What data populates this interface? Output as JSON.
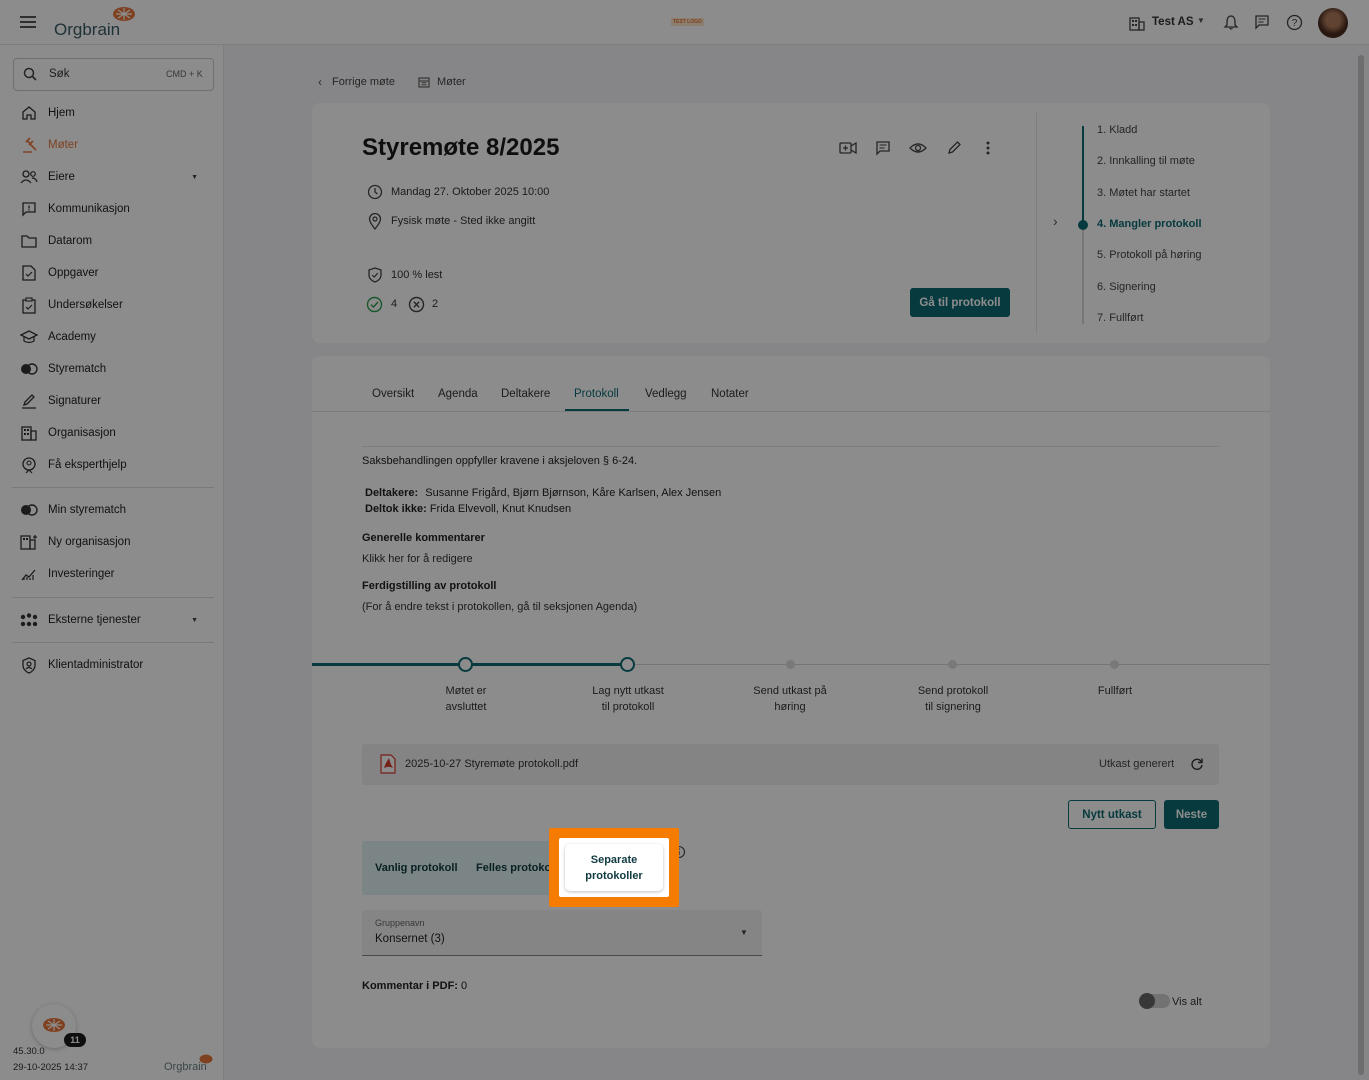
{
  "topbar": {
    "logo_text": "Orgbrain",
    "test_logo": "TEST LOGO",
    "org_name": "Test AS"
  },
  "sidebar": {
    "search_label": "Søk",
    "search_shortcut": "CMD + K",
    "items": [
      {
        "label": "Hjem",
        "icon": "home-icon"
      },
      {
        "label": "Møter",
        "icon": "gavel-icon"
      },
      {
        "label": "Eiere",
        "icon": "people-icon"
      },
      {
        "label": "Kommunikasjon",
        "icon": "message-icon"
      },
      {
        "label": "Datarom",
        "icon": "folder-icon"
      },
      {
        "label": "Oppgaver",
        "icon": "task-icon"
      },
      {
        "label": "Undersøkelser",
        "icon": "clipboard-icon"
      },
      {
        "label": "Academy",
        "icon": "graduation-icon"
      },
      {
        "label": "Styrematch",
        "icon": "match-icon"
      },
      {
        "label": "Signaturer",
        "icon": "pen-icon"
      },
      {
        "label": "Organisasjon",
        "icon": "building-icon"
      },
      {
        "label": "Få eksperthjelp",
        "icon": "expert-icon"
      }
    ],
    "items2": [
      {
        "label": "Min styrematch",
        "icon": "match-icon"
      },
      {
        "label": "Ny organisasjon",
        "icon": "building-plus-icon"
      },
      {
        "label": "Investeringer",
        "icon": "chart-icon"
      }
    ],
    "external_services": "Eksterne tjenester",
    "client_admin": "Klientadministrator",
    "badge_count": "11",
    "version": "45.30.0",
    "version_date": "29-10-2025 14:37",
    "footer_logo": "Orgbrain"
  },
  "breadcrumb": {
    "prev": "Forrige møte",
    "meetings": "Møter"
  },
  "meeting": {
    "title": "Styremøte 8/2025",
    "datetime": "Mandag 27. Oktober 2025 10:00",
    "location": "Fysisk møte - Sted ikke angitt",
    "read_status": "100 % lest",
    "accepted": "4",
    "declined": "2",
    "go_protocol": "Gå til protokoll"
  },
  "status_steps": [
    "1. Kladd",
    "2. Innkalling til møte",
    "3. Møtet har startet",
    "4. Mangler protokoll",
    "5. Protokoll på høring",
    "6. Signering",
    "7. Fullført"
  ],
  "tabs": [
    "Oversikt",
    "Agenda",
    "Deltakere",
    "Protokoll",
    "Vedlegg",
    "Notater"
  ],
  "protocol": {
    "compliance": "Saksbehandlingen oppfyller kravene i aksjeloven § 6-24.",
    "participants_label": "Deltakere:",
    "participants": "Susanne Frigård, Bjørn Bjørnson, Kåre Karlsen, Alex Jensen",
    "absent_label": "Deltok ikke:",
    "absent": "Frida Elvevoll, Knut Knudsen",
    "general_comments_title": "Generelle kommentarer",
    "general_comments_hint": "Klikk her for å redigere",
    "finish_title": "Ferdigstilling av protokoll",
    "finish_hint": "(For å endre tekst i protokollen, gå til seksjonen Agenda)"
  },
  "progress_steps": [
    {
      "line1": "Møtet er",
      "line2": "avsluttet"
    },
    {
      "line1": "Lag nytt utkast",
      "line2": "til protokoll"
    },
    {
      "line1": "Send utkast på",
      "line2": "høring"
    },
    {
      "line1": "Send protokoll",
      "line2": "til signering"
    },
    {
      "line1": "Fullført",
      "line2": ""
    }
  ],
  "file": {
    "name": "2025-10-27 Styremøte protokoll.pdf",
    "status": "Utkast generert"
  },
  "buttons": {
    "new_draft": "Nytt utkast",
    "next": "Neste"
  },
  "protocol_types": {
    "regular": "Vanlig protokoll",
    "shared": "Felles protokoll",
    "separate_line1": "Separate",
    "separate_line2": "protokoller"
  },
  "group": {
    "label": "Gruppenavn",
    "value": "Konsernet (3)"
  },
  "comment_pdf": {
    "label": "Kommentar i PDF:",
    "value": "0"
  },
  "show_all": "Vis alt",
  "colors": {
    "accent": "#0e6b73",
    "highlight": "#f57c00",
    "orange_brand": "#e8763a"
  }
}
